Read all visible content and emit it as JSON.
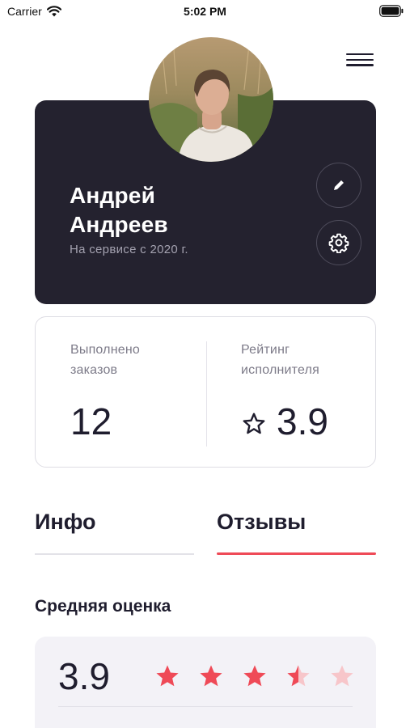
{
  "status_bar": {
    "carrier": "Carrier",
    "time": "5:02 PM"
  },
  "profile": {
    "first_name": "Андрей",
    "last_name": "Андреев",
    "since": "На сервисе с 2020 г."
  },
  "stats": {
    "orders_label_line1": "Выполнено",
    "orders_label_line2": "заказов",
    "orders_value": "12",
    "rating_label_line1": "Рейтинг",
    "rating_label_line2": "исполнителя",
    "rating_value": "3.9"
  },
  "tabs": [
    {
      "label": "Инфо",
      "active": false
    },
    {
      "label": "Отзывы",
      "active": true
    }
  ],
  "reviews": {
    "section_title": "Средняя оценка",
    "average": "3.9",
    "stars_filled": 3.5,
    "stars_total": 5
  },
  "colors": {
    "accent": "#ef4a57",
    "dark_card": "#24222f",
    "star_empty": "#f7c6ca"
  },
  "icons": [
    "wifi-icon",
    "battery-icon",
    "menu-icon",
    "edit-icon",
    "gear-icon",
    "star-outline-icon",
    "star-icon"
  ]
}
